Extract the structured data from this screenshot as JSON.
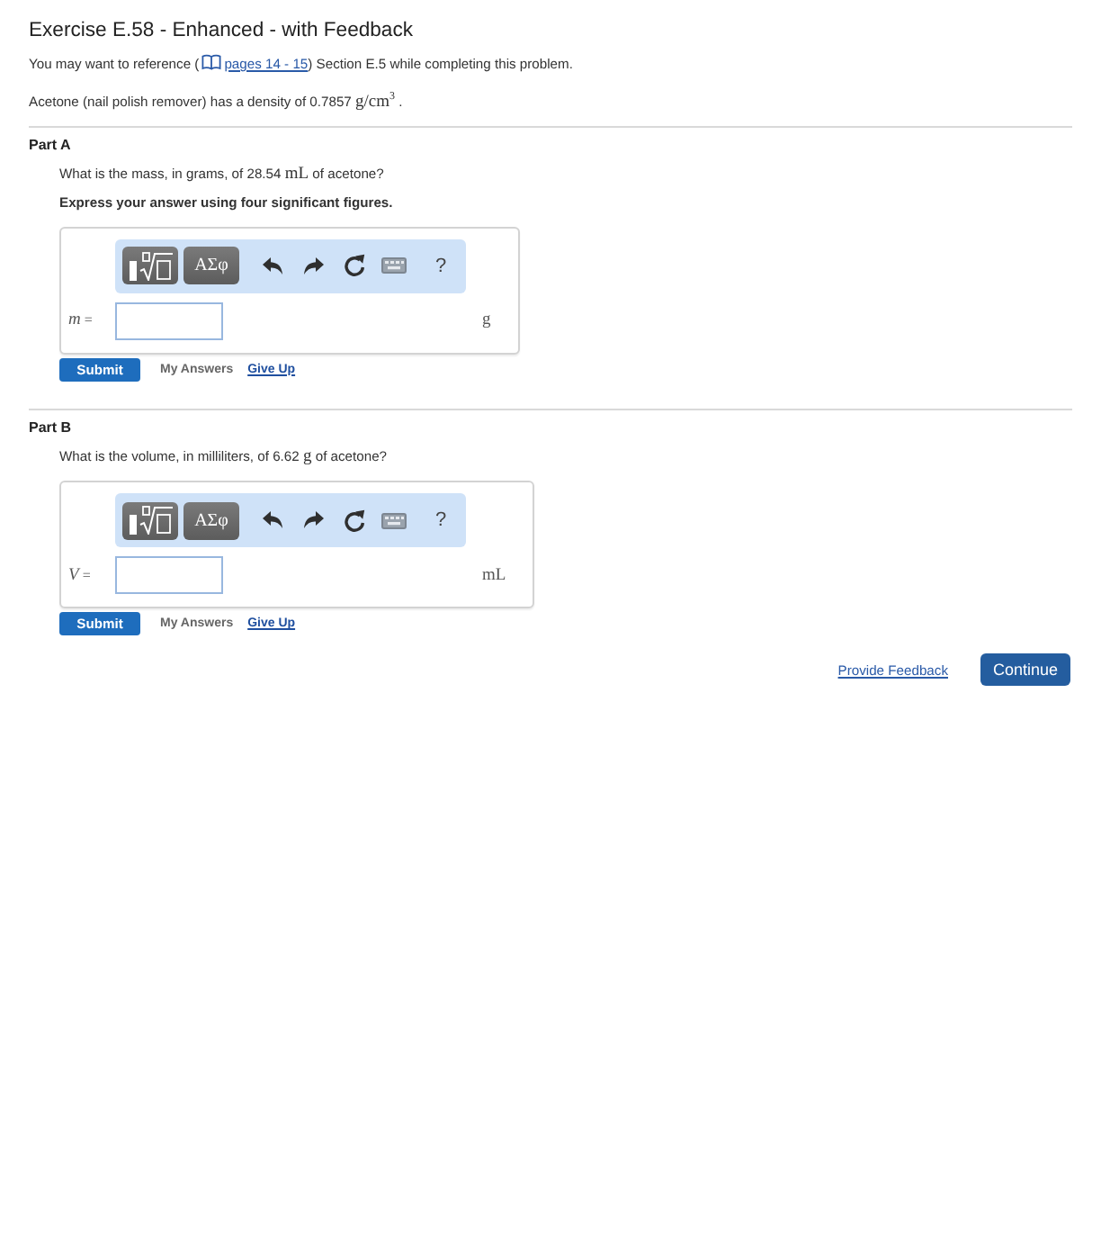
{
  "header": {
    "title": "Exercise E.58 - Enhanced - with Feedback",
    "reference": [
      {
        "kind": "text",
        "text": "You may want to reference ("
      },
      {
        "kind": "link",
        "text": "pages 14 - 15"
      },
      {
        "kind": "text",
        "text": ") Section E.5 while completing this problem."
      }
    ],
    "statement": [
      {
        "kind": "text",
        "text": "Acetone (nail polish remover) has a density of 0.7857 "
      },
      {
        "kind": "math",
        "text": "g/cm$^{3}$"
      },
      {
        "kind": "text",
        "text": " ."
      }
    ]
  },
  "parts": [
    {
      "heading": "Part A",
      "question": [
        {
          "kind": "text",
          "text": "What is the mass, in grams, of 28.54 "
        },
        {
          "kind": "math",
          "text": "mL"
        },
        {
          "kind": "text",
          "text": " of acetone?"
        }
      ],
      "instruction": "Express your answer using four significant figures.",
      "toolbar": [
        {
          "kind": "templates"
        },
        {
          "kind": "symbols",
          "label": "ΑΣφ"
        },
        {
          "kind": "undo"
        },
        {
          "kind": "redo"
        },
        {
          "kind": "reset"
        },
        {
          "kind": "keyboard"
        },
        {
          "kind": "help",
          "label": "?"
        }
      ],
      "variable": "*m* =",
      "unit": "g",
      "submit": "Submit",
      "my_answers": "My Answers",
      "give_up": "Give Up"
    },
    {
      "heading": "Part B",
      "question": [
        {
          "kind": "text",
          "text": "What is the volume, in milliliters, of 6.62 "
        },
        {
          "kind": "math",
          "text": "g"
        },
        {
          "kind": "text",
          "text": " of acetone?"
        }
      ],
      "toolbar": [
        {
          "kind": "templates"
        },
        {
          "kind": "symbols",
          "label": "ΑΣφ"
        },
        {
          "kind": "undo"
        },
        {
          "kind": "redo"
        },
        {
          "kind": "reset"
        },
        {
          "kind": "keyboard"
        },
        {
          "kind": "help",
          "label": "?"
        }
      ],
      "variable": "*V* =",
      "unit": "mL",
      "submit": "Submit",
      "my_answers": "My Answers",
      "give_up": "Give Up"
    }
  ],
  "footer": {
    "feedback": "Provide Feedback",
    "continue": "Continue"
  }
}
